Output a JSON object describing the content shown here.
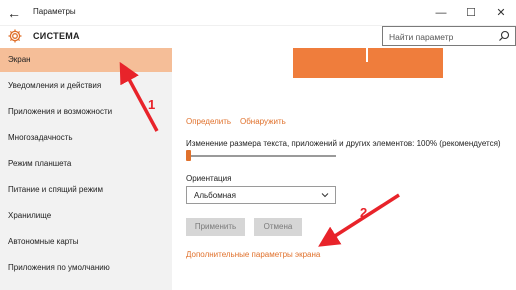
{
  "window": {
    "title": "Параметры",
    "back_icon": "←",
    "minimize_icon": "—",
    "maximize_icon": "☐",
    "close_icon": "✕"
  },
  "header": {
    "section_title": "СИСТЕМА",
    "search_placeholder": "Найти параметр"
  },
  "sidebar": {
    "items": [
      {
        "label": "Экран",
        "active": true
      },
      {
        "label": "Уведомления и действия"
      },
      {
        "label": "Приложения и возможности"
      },
      {
        "label": "Многозадачность"
      },
      {
        "label": "Режим планшета"
      },
      {
        "label": "Питание и спящий режим"
      },
      {
        "label": "Хранилище"
      },
      {
        "label": "Автономные карты"
      },
      {
        "label": "Приложения по умолчанию"
      }
    ]
  },
  "main": {
    "identify_link": "Определить",
    "detect_link": "Обнаружить",
    "scale_label": "Изменение размера текста, приложений и других элементов: 100% (рекомендуется)",
    "scale_value": 0,
    "orientation_label": "Ориентация",
    "orientation_value": "Альбомная",
    "apply_button": "Применить",
    "cancel_button": "Отмена",
    "advanced_link": "Дополнительные параметры экрана"
  },
  "annotations": [
    {
      "label": "1"
    },
    {
      "label": "2"
    }
  ],
  "colors": {
    "accent": "#e0712c",
    "active_item": "#f5be98",
    "preview": "#ef7d3c",
    "arrow": "#e8232a"
  }
}
